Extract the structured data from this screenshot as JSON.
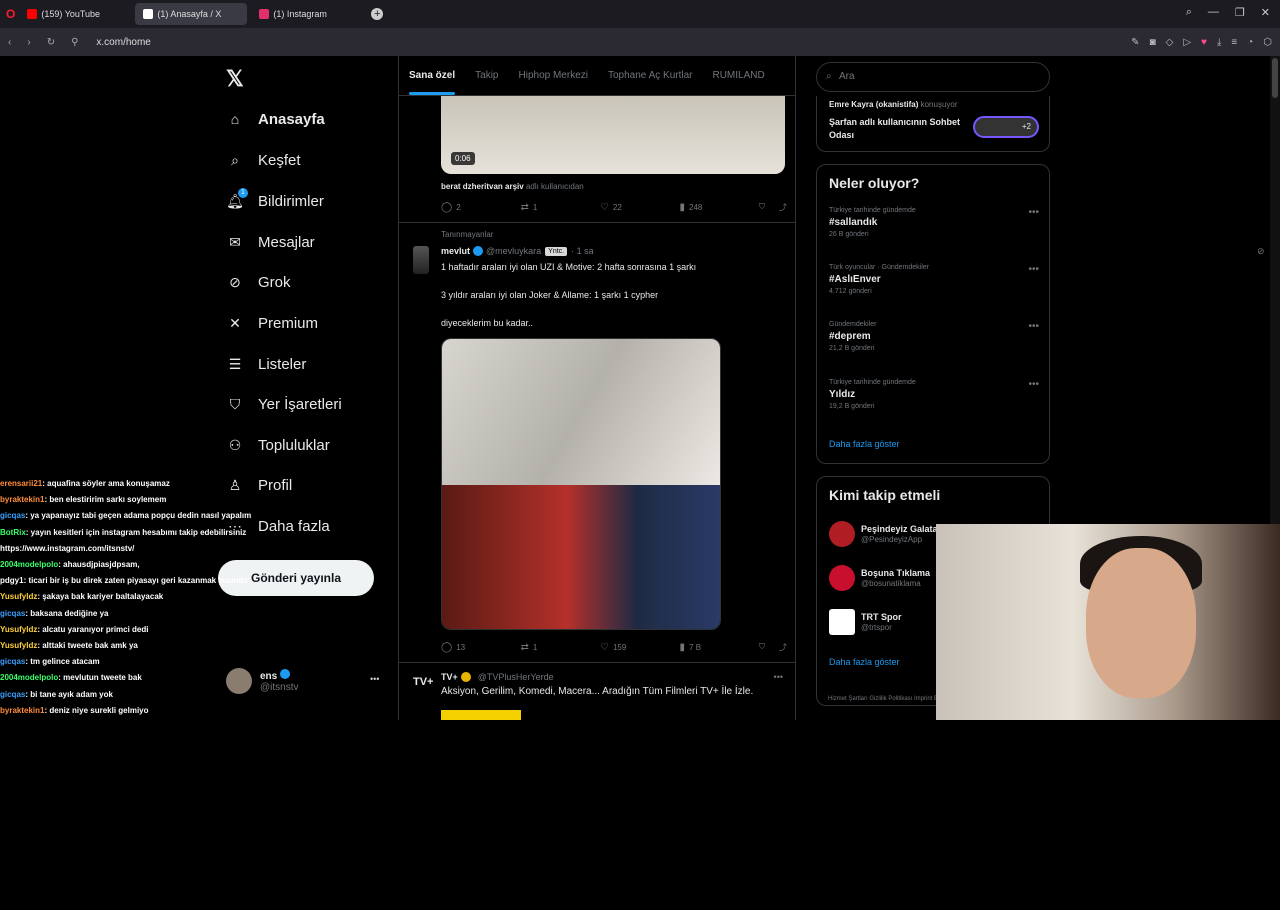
{
  "browser": {
    "tabs": [
      {
        "label": "(159) YouTube",
        "color": "#ff0000"
      },
      {
        "label": "(1) Anasayfa / X",
        "color": "#ffffff"
      },
      {
        "label": "(1) Instagram",
        "color": "#e1306c"
      }
    ],
    "url": "x.com/home"
  },
  "nav": {
    "items": [
      {
        "label": "Anasayfa",
        "icon": "home-icon"
      },
      {
        "label": "Keşfet",
        "icon": "search-icon"
      },
      {
        "label": "Bildirimler",
        "icon": "bell-icon",
        "badge": "1"
      },
      {
        "label": "Mesajlar",
        "icon": "mail-icon"
      },
      {
        "label": "Grok",
        "icon": "grok-icon"
      },
      {
        "label": "Premium",
        "icon": "x-icon"
      },
      {
        "label": "Listeler",
        "icon": "list-icon"
      },
      {
        "label": "Yer İşaretleri",
        "icon": "bookmark-icon"
      },
      {
        "label": "Topluluklar",
        "icon": "people-icon"
      },
      {
        "label": "Profil",
        "icon": "user-icon"
      },
      {
        "label": "Daha fazla",
        "icon": "more-icon"
      }
    ],
    "post_button": "Gönderi yayınla",
    "profile": {
      "name": "ens",
      "handle": "@itsnstv"
    }
  },
  "feed": {
    "tabs": [
      "Sana özel",
      "Takip",
      "Hiphop Merkezi",
      "Tophane Aç Kurtlar",
      "RUMILAND"
    ],
    "video_duration": "0:06",
    "video_source_name": "berat dzheritvan arşiv",
    "video_source_suffix": "adlı kullanıcıdan",
    "post1_stats": {
      "replies": "2",
      "reposts": "1",
      "likes": "22",
      "views": "248"
    },
    "recommended": "Tanınmayanlar",
    "tweet": {
      "name": "mevlut",
      "handle": "@mevluykara",
      "tag": "Yntc.",
      "time": "· 1 sa",
      "line1": "1 haftadır araları iyi olan UZI & Motive: 2 hafta sonrasına 1 şarkı",
      "line2": "3 yıldır araları iyi olan Joker & Allame: 1 şarkı 1 cypher",
      "line3": "diyeceklerim bu kadar..",
      "stats": {
        "replies": "13",
        "reposts": "1",
        "likes": "159",
        "views": "7 B"
      }
    },
    "ad": {
      "logo": "TV+",
      "name": "TV+",
      "handle": "@TVPlusHerYerde",
      "text": "Aksiyon, Gerilim, Komedi, Macera... Aradığın Tüm Filmleri TV+ İle İzle."
    }
  },
  "sidebar": {
    "search_placeholder": "Ara",
    "chat": {
      "who": "Emre Kayra (okanistifa)",
      "who_suffix": "konuşuyor",
      "room": "Şarfan adlı kullanıcının Sohbet Odası",
      "extra": "+2"
    },
    "trends_title": "Neler oluyor?",
    "trends": [
      {
        "context": "Türkiye tarihinde gündemde",
        "topic": "#sallandık",
        "count": "26 B gönderi"
      },
      {
        "context": "Türk oyuncular · Gündemdekiler",
        "topic": "#AslıEnver",
        "count": "4.712 gönderi"
      },
      {
        "context": "Gündemdekiler",
        "topic": "#deprem",
        "count": "21,2 B gönderi"
      },
      {
        "context": "Türkiye tarihinde gündemde",
        "topic": "Yıldız",
        "count": "19,2 B gönderi"
      }
    ],
    "show_more": "Daha fazla göster",
    "follow_title": "Kimi takip etmeli",
    "follow": [
      {
        "name": "Peşindeyiz Galata",
        "handle": "@PesindeyizApp",
        "color": "#b01e24"
      },
      {
        "name": "Boşuna Tıklama",
        "handle": "@bosunatiklama",
        "color": "#c8102e"
      },
      {
        "name": "TRT Spor",
        "handle": "@trtspor",
        "color": "#ffffff"
      }
    ],
    "follow_more": "Daha fazla göster",
    "footer": "Hizmet Şartları   Gizlilik Politikası   Imprint   Erişilebilirlik   Reklam"
  },
  "chatlog": [
    {
      "user": "erensarii21",
      "msg": ": aquafina söyler ama konuşamaz",
      "color": "#ff8c3a"
    },
    {
      "user": "byraktekin1",
      "msg": ": ben elestiririm sarkı soylemem",
      "color": "#ff8c3a"
    },
    {
      "user": "gicqas",
      "msg": ": ya yapanayız tabi geçen adama popçu dedin nasıl yapalım",
      "color": "#3aa0ff"
    },
    {
      "user": "BotRix",
      "msg": ": yayın kesitleri için instagram hesabımı takip edebilirsiniz",
      "color": "#3aff6a"
    },
    {
      "user": "",
      "msg": "https://www.instagram.com/itsnstv/",
      "color": "#ffffff"
    },
    {
      "user": "2004modelpolo",
      "msg": ": ahausdjpiasjdpsam,",
      "color": "#3aff6a"
    },
    {
      "user": "pdgy1",
      "msg": ": ticari bir iş bu direk zaten piyasayı geri kazanmak lazımdır",
      "color": "#ffffff"
    },
    {
      "user": "Yusufyldz",
      "msg": ": şakaya bak kariyer baltalayacak",
      "color": "#ffd23a"
    },
    {
      "user": "gicqas",
      "msg": ": baksana dediğine ya",
      "color": "#3aa0ff"
    },
    {
      "user": "Yusufyldz",
      "msg": ": alcatu yaranıyor primci dedi",
      "color": "#ffd23a"
    },
    {
      "user": "Yusufyldz",
      "msg": ": alttaki tweete bak amk ya",
      "color": "#ffd23a"
    },
    {
      "user": "gicqas",
      "msg": ": tm gelince atacam",
      "color": "#3aa0ff"
    },
    {
      "user": "2004modelpolo",
      "msg": ": mevlutun tweete bak",
      "color": "#3aff6a"
    },
    {
      "user": "gicqas",
      "msg": ": bi tane ayık adam yok",
      "color": "#3aa0ff"
    },
    {
      "user": "byraktekin1",
      "msg": ": deniz niye surekli gelmiyo",
      "color": "#ff8c3a"
    }
  ]
}
